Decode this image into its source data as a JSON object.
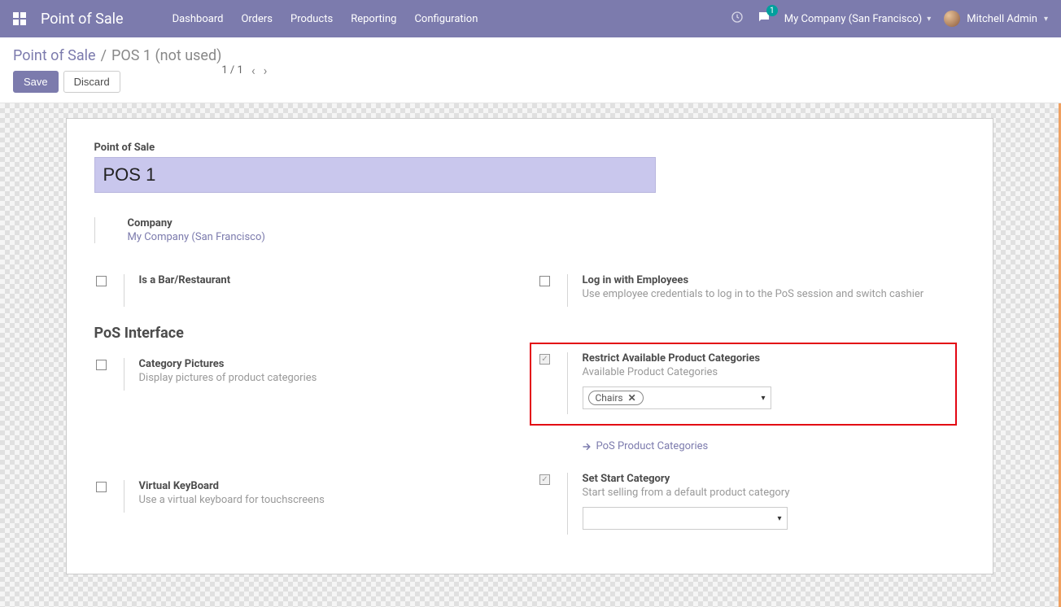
{
  "topbar": {
    "app_title": "Point of Sale",
    "nav": [
      "Dashboard",
      "Orders",
      "Products",
      "Reporting",
      "Configuration"
    ],
    "chat_badge": "1",
    "company": "My Company (San Francisco)",
    "user": "Mitchell Admin"
  },
  "breadcrumb": {
    "root": "Point of Sale",
    "current": "POS 1 (not used)"
  },
  "buttons": {
    "save": "Save",
    "discard": "Discard"
  },
  "pager": {
    "text": "1 / 1"
  },
  "form": {
    "pos_label": "Point of Sale",
    "pos_name": "POS 1",
    "company_label": "Company",
    "company_value": "My Company (San Francisco)",
    "section_interface": "PoS Interface",
    "settings": {
      "bar": {
        "title": "Is a Bar/Restaurant"
      },
      "login_emp": {
        "title": "Log in with Employees",
        "desc": "Use employee credentials to log in to the PoS session and switch cashier"
      },
      "cat_pics": {
        "title": "Category Pictures",
        "desc": "Display pictures of product categories"
      },
      "restrict": {
        "title": "Restrict Available Product Categories",
        "desc": "Available Product Categories",
        "tag": "Chairs",
        "link": "PoS Product Categories"
      },
      "vkb": {
        "title": "Virtual KeyBoard",
        "desc": "Use a virtual keyboard for touchscreens"
      },
      "start_cat": {
        "title": "Set Start Category",
        "desc": "Start selling from a default product category"
      }
    }
  }
}
